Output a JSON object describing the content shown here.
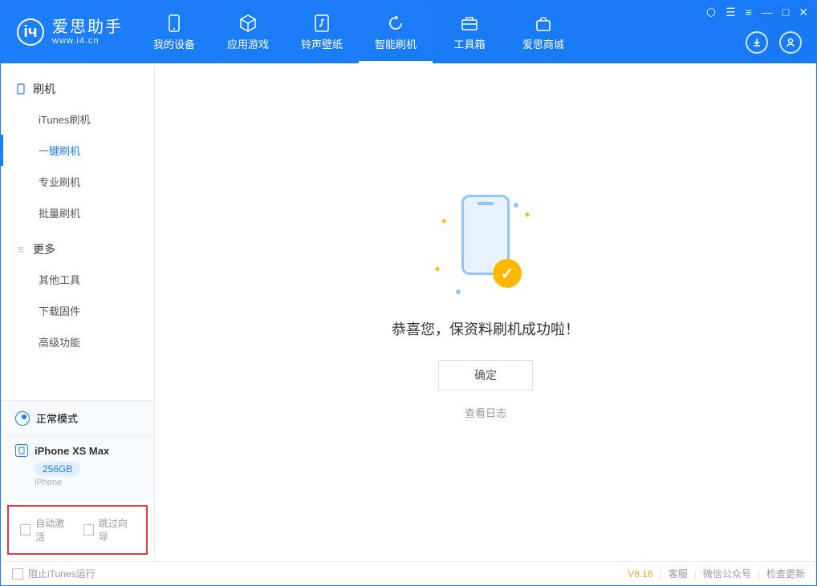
{
  "app": {
    "title": "爱思助手",
    "url": "www.i4.cn"
  },
  "nav": [
    {
      "label": "我的设备",
      "icon": "device-icon"
    },
    {
      "label": "应用游戏",
      "icon": "cube-icon"
    },
    {
      "label": "铃声壁纸",
      "icon": "music-icon"
    },
    {
      "label": "智能刷机",
      "icon": "refresh-icon"
    },
    {
      "label": "工具箱",
      "icon": "toolbox-icon"
    },
    {
      "label": "爱思商城",
      "icon": "shop-icon"
    }
  ],
  "active_nav_index": 3,
  "sidebar": {
    "group1": {
      "label": "刷机"
    },
    "items1": [
      {
        "label": "iTunes刷机"
      },
      {
        "label": "一键刷机"
      },
      {
        "label": "专业刷机"
      },
      {
        "label": "批量刷机"
      }
    ],
    "active_item1_index": 1,
    "group2": {
      "label": "更多"
    },
    "items2": [
      {
        "label": "其他工具"
      },
      {
        "label": "下载固件"
      },
      {
        "label": "高级功能"
      }
    ]
  },
  "mode": {
    "label": "正常模式"
  },
  "device": {
    "name": "iPhone XS Max",
    "capacity": "256GB",
    "sub": "iPhone"
  },
  "options": {
    "auto_activate": "自动激活",
    "skip_wizard": "跳过向导"
  },
  "main": {
    "success_message": "恭喜您，保资料刷机成功啦！",
    "ok_button": "确定",
    "log_link": "查看日志"
  },
  "footer": {
    "block_itunes": "阻止iTunes运行",
    "version": "V8.16",
    "links": [
      "客服",
      "微信公众号",
      "检查更新"
    ]
  }
}
